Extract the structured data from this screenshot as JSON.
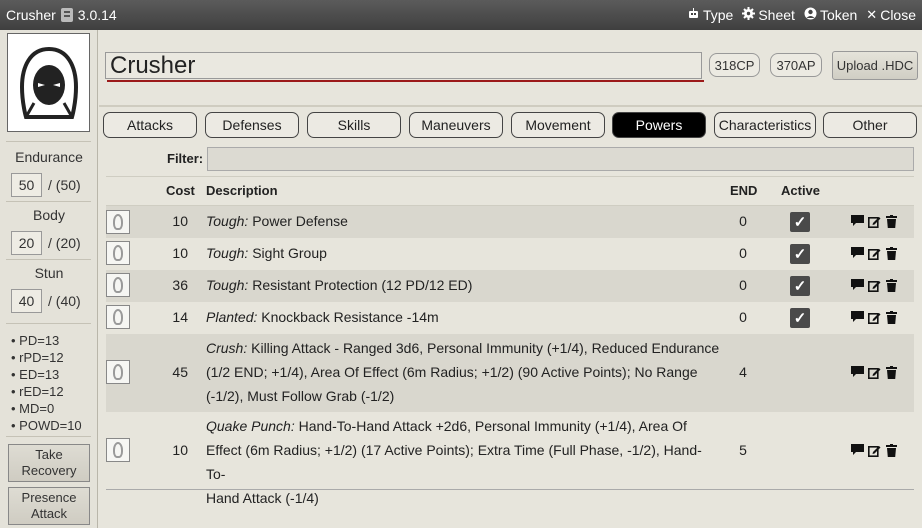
{
  "titlebar": {
    "app_name": "Crusher",
    "version": "3.0.14",
    "actions": [
      {
        "label": "Type",
        "icon": "robot-icon"
      },
      {
        "label": "Sheet",
        "icon": "gear-icon"
      },
      {
        "label": "Token",
        "icon": "user-circle-icon"
      },
      {
        "label": "Close",
        "icon": "close-icon"
      }
    ]
  },
  "sidebar": {
    "endurance": {
      "label": "Endurance",
      "value": "50",
      "max": "/ (50)"
    },
    "body": {
      "label": "Body",
      "value": "20",
      "max": "/ (20)"
    },
    "stun": {
      "label": "Stun",
      "value": "40",
      "max": "/ (40)"
    },
    "defenses": [
      "PD=13",
      "rPD=12",
      "ED=13",
      "rED=12",
      "MD=0",
      "POWD=10"
    ],
    "buttons": [
      {
        "label_line1": "Take",
        "label_line2": "Recovery"
      },
      {
        "label_line1": "Presence",
        "label_line2": "Attack"
      }
    ]
  },
  "header": {
    "name": "Crusher",
    "cp": "318CP",
    "ap": "370AP",
    "upload_label": "Upload .HDC"
  },
  "tabs": [
    {
      "label": "Attacks",
      "active": false
    },
    {
      "label": "Defenses",
      "active": false
    },
    {
      "label": "Skills",
      "active": false
    },
    {
      "label": "Maneuvers",
      "active": false
    },
    {
      "label": "Movement",
      "active": false
    },
    {
      "label": "Powers",
      "active": true
    },
    {
      "label": "Characteristics",
      "active": false
    },
    {
      "label": "Other",
      "active": false
    }
  ],
  "table": {
    "filter_label": "Filter:",
    "filter_value": "",
    "headers": {
      "cost": "Cost",
      "description": "Description",
      "end": "END",
      "active": "Active"
    },
    "rows": [
      {
        "cost": "10",
        "name": "Tough:",
        "text": "Power Defense",
        "end": "0",
        "active": true
      },
      {
        "cost": "10",
        "name": "Tough:",
        "text": "Sight Group",
        "end": "0",
        "active": true
      },
      {
        "cost": "36",
        "name": "Tough:",
        "text": "Resistant Protection (12 PD/12 ED)",
        "end": "0",
        "active": true
      },
      {
        "cost": "14",
        "name": "Planted:",
        "text": "Knockback Resistance -14m",
        "end": "0",
        "active": true
      },
      {
        "cost": "45",
        "name": "Crush:",
        "lines": [
          "Killing Attack - Ranged 3d6, Personal Immunity (+1/4), Reduced Endurance",
          "(1/2 END; +1/4), Area Of Effect (6m Radius; +1/2) (90 Active Points); No Range",
          "(-1/2), Must Follow Grab (-1/2)"
        ],
        "end": "4",
        "active": null
      },
      {
        "cost": "10",
        "name": "Quake Punch:",
        "lines": [
          "Hand-To-Hand Attack +2d6, Personal Immunity (+1/4), Area Of",
          "Effect (6m Radius; +1/2) (17 Active Points); Extra Time (Full Phase, -1/2), Hand-To-",
          "Hand Attack (-1/4)"
        ],
        "end": "5",
        "active": null
      }
    ]
  }
}
